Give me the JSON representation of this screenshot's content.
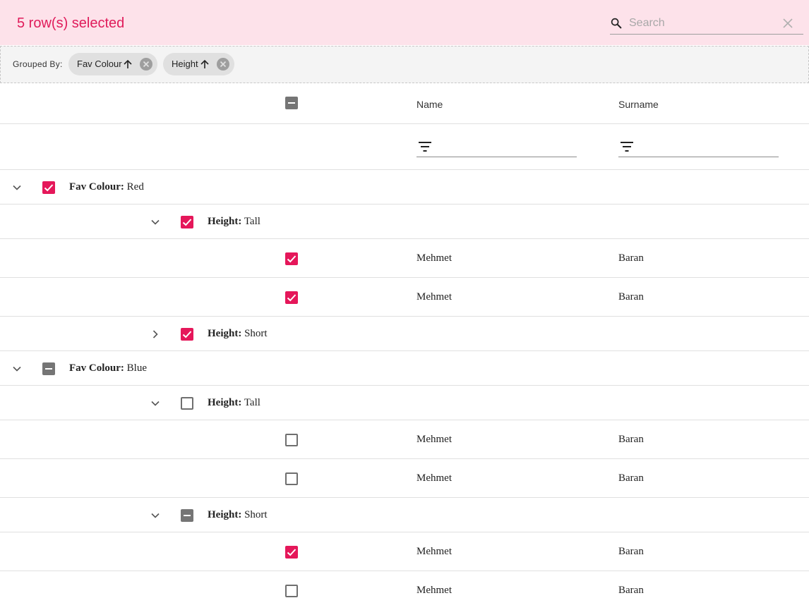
{
  "toolbar": {
    "selection_title": "5 row(s) selected",
    "search": {
      "placeholder": "Search",
      "value": ""
    },
    "accent_color": "#e5175a",
    "background_color": "#fde2ea"
  },
  "grouping": {
    "label": "Grouped By:",
    "chips": [
      {
        "label": "Fav Colour",
        "sort_direction": "ascending",
        "icon": "arrow-up-icon"
      },
      {
        "label": "Height",
        "sort_direction": "ascending",
        "icon": "arrow-up-icon"
      }
    ]
  },
  "columns": [
    {
      "label": "Name",
      "filter_icon": "filter-icon"
    },
    {
      "label": "Surname",
      "filter_icon": "filter-icon"
    }
  ],
  "header_checkbox_state": "indeterminate",
  "rows": [
    {
      "type": "group",
      "level": 0,
      "expanded": true,
      "checkbox": "checked",
      "field": "Fav Colour:",
      "value": "Red"
    },
    {
      "type": "group",
      "level": 1,
      "expanded": true,
      "checkbox": "checked",
      "field": "Height:",
      "value": "Tall"
    },
    {
      "type": "data",
      "checkbox": "checked",
      "name": "Mehmet",
      "surname": "Baran"
    },
    {
      "type": "data",
      "checkbox": "checked",
      "name": "Mehmet",
      "surname": "Baran"
    },
    {
      "type": "group",
      "level": 1,
      "expanded": false,
      "checkbox": "checked",
      "field": "Height:",
      "value": "Short"
    },
    {
      "type": "group",
      "level": 0,
      "expanded": true,
      "checkbox": "indeterminate",
      "field": "Fav Colour:",
      "value": "Blue"
    },
    {
      "type": "group",
      "level": 1,
      "expanded": true,
      "checkbox": "unchecked",
      "field": "Height:",
      "value": "Tall"
    },
    {
      "type": "data",
      "checkbox": "unchecked",
      "name": "Mehmet",
      "surname": "Baran"
    },
    {
      "type": "data",
      "checkbox": "unchecked",
      "name": "Mehmet",
      "surname": "Baran"
    },
    {
      "type": "group",
      "level": 1,
      "expanded": true,
      "checkbox": "indeterminate",
      "field": "Height:",
      "value": "Short"
    },
    {
      "type": "data",
      "checkbox": "checked",
      "name": "Mehmet",
      "surname": "Baran"
    },
    {
      "type": "data",
      "checkbox": "unchecked",
      "name": "Mehmet",
      "surname": "Baran"
    }
  ]
}
